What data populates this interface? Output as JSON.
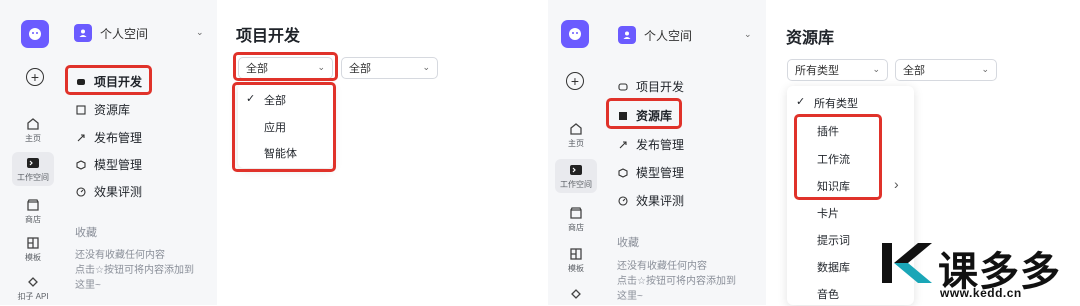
{
  "colors": {
    "accent": "#6b5bff",
    "highlight_box": "#e0322a",
    "brand_dark": "#111111",
    "brand_teal": "#1aa6b7"
  },
  "left": {
    "rail": [
      {
        "label": "主页",
        "icon": "home-icon"
      },
      {
        "label": "工作空间",
        "icon": "workspace-icon"
      },
      {
        "label": "商店",
        "icon": "store-icon"
      },
      {
        "label": "模板",
        "icon": "template-icon"
      },
      {
        "label": "扣子 API",
        "icon": "api-icon"
      }
    ],
    "space": "个人空间",
    "nav": [
      "项目开发",
      "资源库",
      "发布管理",
      "模型管理",
      "效果评测"
    ],
    "favorites": {
      "title": "收藏",
      "line1": "还没有收藏任何内容",
      "line2": "点击☆按钮可将内容添加到",
      "line3": "这里~"
    },
    "page_title": "项目开发",
    "filter1": "全部",
    "filter2": "全部",
    "menu": [
      "全部",
      "应用",
      "智能体"
    ]
  },
  "right": {
    "rail": [
      {
        "label": "主页",
        "icon": "home-icon"
      },
      {
        "label": "工作空间",
        "icon": "workspace-icon"
      },
      {
        "label": "商店",
        "icon": "store-icon"
      },
      {
        "label": "模板",
        "icon": "template-icon"
      }
    ],
    "space": "个人空间",
    "nav": [
      "项目开发",
      "资源库",
      "发布管理",
      "模型管理",
      "效果评测"
    ],
    "favorites": {
      "title": "收藏",
      "line1": "还没有收藏任何内容",
      "line2": "点击☆按钮可将内容添加到",
      "line3": "这里~"
    },
    "page_title": "资源库",
    "filter1": "所有类型",
    "filter2": "全部",
    "menu": [
      "所有类型",
      "插件",
      "工作流",
      "知识库",
      "卡片",
      "提示词",
      "数据库",
      "音色"
    ]
  },
  "watermark": {
    "brand": "课多多",
    "url": "www.kedd.cn"
  }
}
